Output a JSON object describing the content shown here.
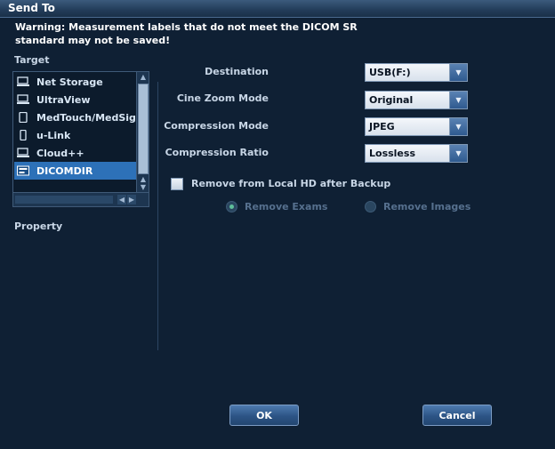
{
  "window": {
    "title": "Send To"
  },
  "warning": "Warning: Measurement labels that do not meet the DICOM SR standard may not be saved!",
  "target": {
    "label": "Target",
    "items": [
      {
        "label": "Net Storage",
        "icon": "network-drive-icon"
      },
      {
        "label": "UltraView",
        "icon": "network-drive-icon"
      },
      {
        "label": "MedTouch/MedSight",
        "icon": "tablet-icon"
      },
      {
        "label": "u-Link",
        "icon": "phone-icon"
      },
      {
        "label": "Cloud++",
        "icon": "cloud-drive-icon"
      },
      {
        "label": "DICOMDIR",
        "icon": "dicomdir-icon",
        "selected": true
      }
    ]
  },
  "property": {
    "label": "Property"
  },
  "fields": {
    "destination": {
      "label": "Destination",
      "value": "USB(F:)"
    },
    "cine_zoom_mode": {
      "label": "Cine Zoom Mode",
      "value": "Original"
    },
    "compression_mode": {
      "label": "Compression Mode",
      "value": "JPEG"
    },
    "compression_ratio": {
      "label": "Compression Ratio",
      "value": "Lossless"
    }
  },
  "remove_from_hd": {
    "label": "Remove from Local HD after Backup",
    "checked": false
  },
  "remove_options": {
    "exams": {
      "label": "Remove Exams",
      "selected": true
    },
    "images": {
      "label": "Remove Images",
      "selected": false
    }
  },
  "buttons": {
    "ok": "OK",
    "cancel": "Cancel"
  },
  "colors": {
    "background": "#0f2034",
    "selection": "#2d71b8",
    "button": "#2c5485"
  }
}
